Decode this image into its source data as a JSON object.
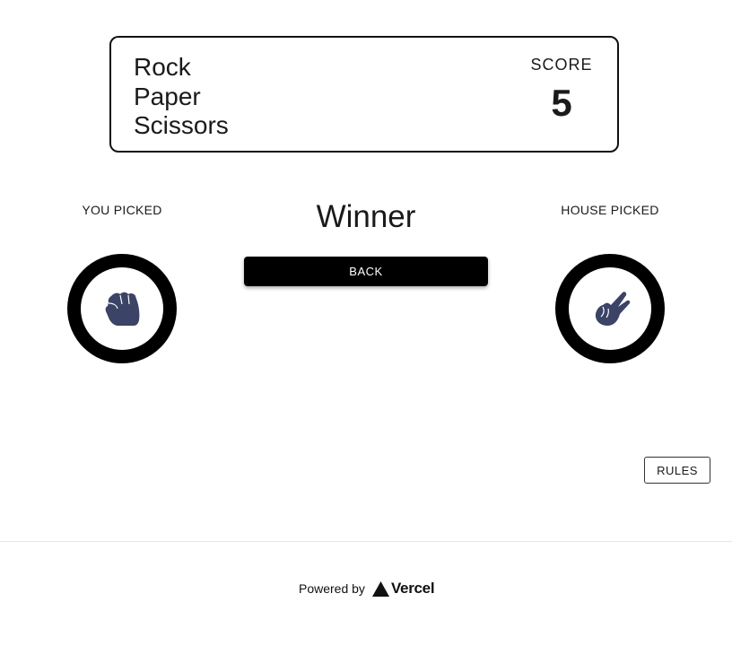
{
  "header": {
    "title_lines": [
      "Rock",
      "Paper",
      "Scissors"
    ],
    "score_label": "SCORE",
    "score_value": "5"
  },
  "player": {
    "label": "YOU PICKED",
    "choice_icon": "fist-icon"
  },
  "house": {
    "label": "HOUSE PICKED",
    "choice_icon": "scissors-hand-icon"
  },
  "result": {
    "text": "Winner",
    "back_label": "BACK"
  },
  "rules_label": "RULES",
  "footer": {
    "powered_by": "Powered by",
    "brand": "Vercel",
    "brand_icon": "vercel-triangle-icon"
  },
  "colors": {
    "icon_fill": "#3b4366",
    "ring": "#000000",
    "button_bg": "#000000"
  }
}
